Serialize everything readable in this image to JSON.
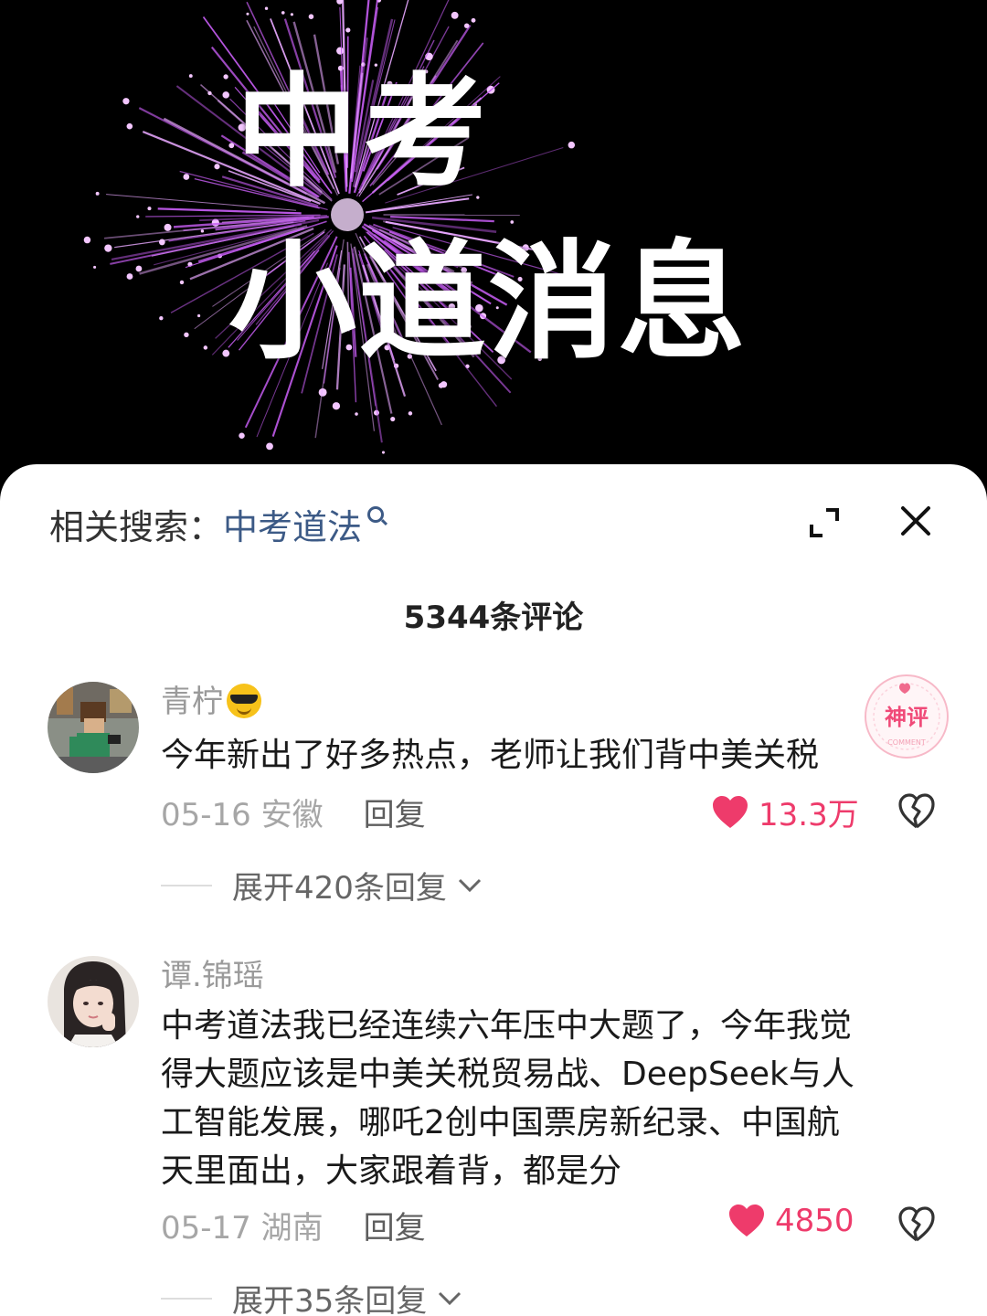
{
  "hero": {
    "line1": "中考",
    "line2": "小道消息",
    "accent": "#c45cf0"
  },
  "sheet": {
    "related_label": "相关搜索：",
    "related_term": "中考道法",
    "comment_count": "5344条评论"
  },
  "comments": [
    {
      "username": "青柠",
      "text_lines": [
        "今年新出了好多热点，老师让我们背中美关税"
      ],
      "date_location": "05-16 安徽",
      "reply": "回复",
      "likes": "13.3万",
      "expand": "展开420条回复",
      "badge": "神评",
      "badge_sub": "COMMENT"
    },
    {
      "username": "谭.锦瑶",
      "text_lines": [
        "中考道法我已经连续六年压中大题了，今年我觉",
        "得大题应该是中美关税贸易战、DeepSeek与人",
        "工智能发展，哪吒2创中国票房新纪录、中国航",
        "天里面出，大家跟着背，都是分"
      ],
      "date_location": "05-17 湖南",
      "reply": "回复",
      "likes": "4850",
      "expand": "展开35条回复"
    }
  ],
  "colors": {
    "like": "#ee3b6b",
    "link": "#3c5a86"
  },
  "icons": [
    "search-icon",
    "expand-icon",
    "close-icon",
    "heart-icon",
    "dislike-icon",
    "chevron-down-icon",
    "sunglasses-emoji"
  ]
}
